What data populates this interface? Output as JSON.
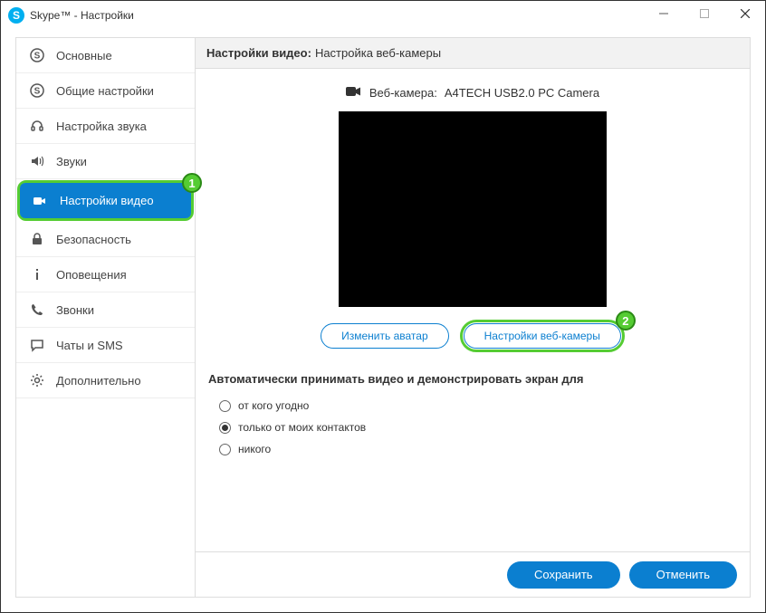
{
  "window": {
    "title": "Skype™ - Настройки"
  },
  "sidebar": {
    "items": [
      {
        "label": "Основные",
        "icon": "skype-icon"
      },
      {
        "label": "Общие настройки",
        "icon": "skype-icon"
      },
      {
        "label": "Настройка звука",
        "icon": "headset-icon"
      },
      {
        "label": "Звуки",
        "icon": "speaker-icon"
      },
      {
        "label": "Настройки видео",
        "icon": "camera-icon"
      },
      {
        "label": "Безопасность",
        "icon": "lock-icon"
      },
      {
        "label": "Оповещения",
        "icon": "info-icon"
      },
      {
        "label": "Звонки",
        "icon": "phone-icon"
      },
      {
        "label": "Чаты и SMS",
        "icon": "chat-icon"
      },
      {
        "label": "Дополнительно",
        "icon": "gear-icon"
      }
    ]
  },
  "content": {
    "header_bold": "Настройки видео:",
    "header_rest": "Настройка веб-камеры",
    "webcam_label": "Веб-камера:",
    "webcam_name": "A4TECH USB2.0 PC Camera",
    "change_avatar": "Изменить аватар",
    "webcam_settings": "Настройки веб-камеры",
    "auto_accept_label": "Автоматически принимать видео и демонстрировать экран для",
    "radios": [
      {
        "label": "от кого угодно"
      },
      {
        "label": "только от моих контактов"
      },
      {
        "label": "никого"
      }
    ]
  },
  "footer": {
    "save": "Сохранить",
    "cancel": "Отменить"
  },
  "annotations": {
    "badge1": "1",
    "badge2": "2"
  }
}
